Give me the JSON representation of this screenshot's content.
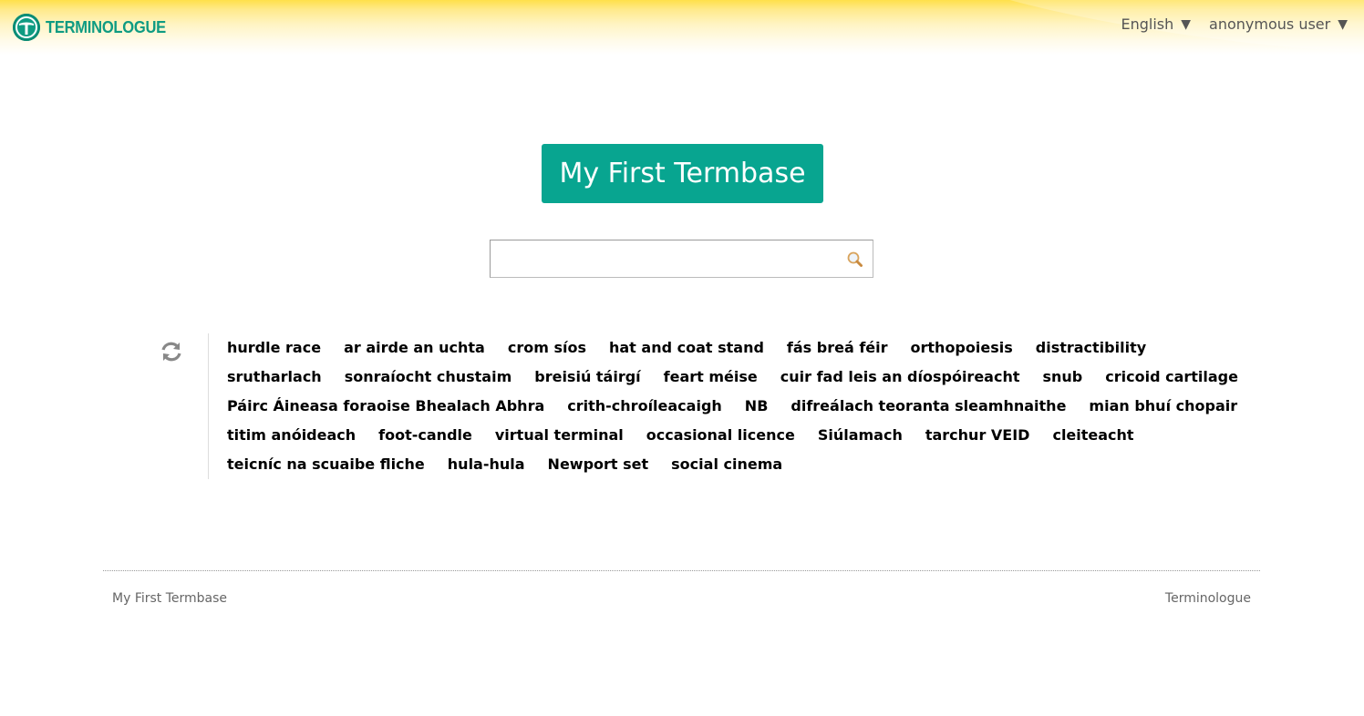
{
  "header": {
    "logo_text": "TERMINOLOGUE",
    "language_menu": {
      "label": "English",
      "caret": "▼"
    },
    "user_menu": {
      "label": "anonymous user",
      "caret": "▼"
    }
  },
  "main": {
    "termbase_title": "My First Termbase",
    "search": {
      "value": "",
      "placeholder": "",
      "icon": "search-icon"
    },
    "refresh_icon": "refresh-icon",
    "random_terms": [
      "hurdle race",
      "ar airde an uchta",
      "crom síos",
      "hat and coat stand",
      "fás breá féir",
      "orthopoiesis",
      "distractibility",
      "srutharlach",
      "sonraíocht chustaim",
      "breisiú táirgí",
      "feart méise",
      "cuir fad leis an díospóireacht",
      "snub",
      "cricoid cartilage",
      "Páirc Áineasa foraoise Bhealach Abhra",
      "crith-chroíleacaigh",
      "NB",
      "difreálach teoranta sleamhnaithe",
      "mian bhuí chopair",
      "titim anóideach",
      "foot-candle",
      "virtual terminal",
      "occasional licence",
      "Siúlamach",
      "tarchur VEID",
      "cleiteacht",
      "teicníc na scuaibe fliche",
      "hula-hula",
      "Newport set",
      "social cinema"
    ]
  },
  "footer": {
    "left_link": "My First Termbase",
    "right_link": "Terminologue"
  },
  "colors": {
    "brand": "#08a590",
    "header_gradient_top": "#ffe04a"
  }
}
